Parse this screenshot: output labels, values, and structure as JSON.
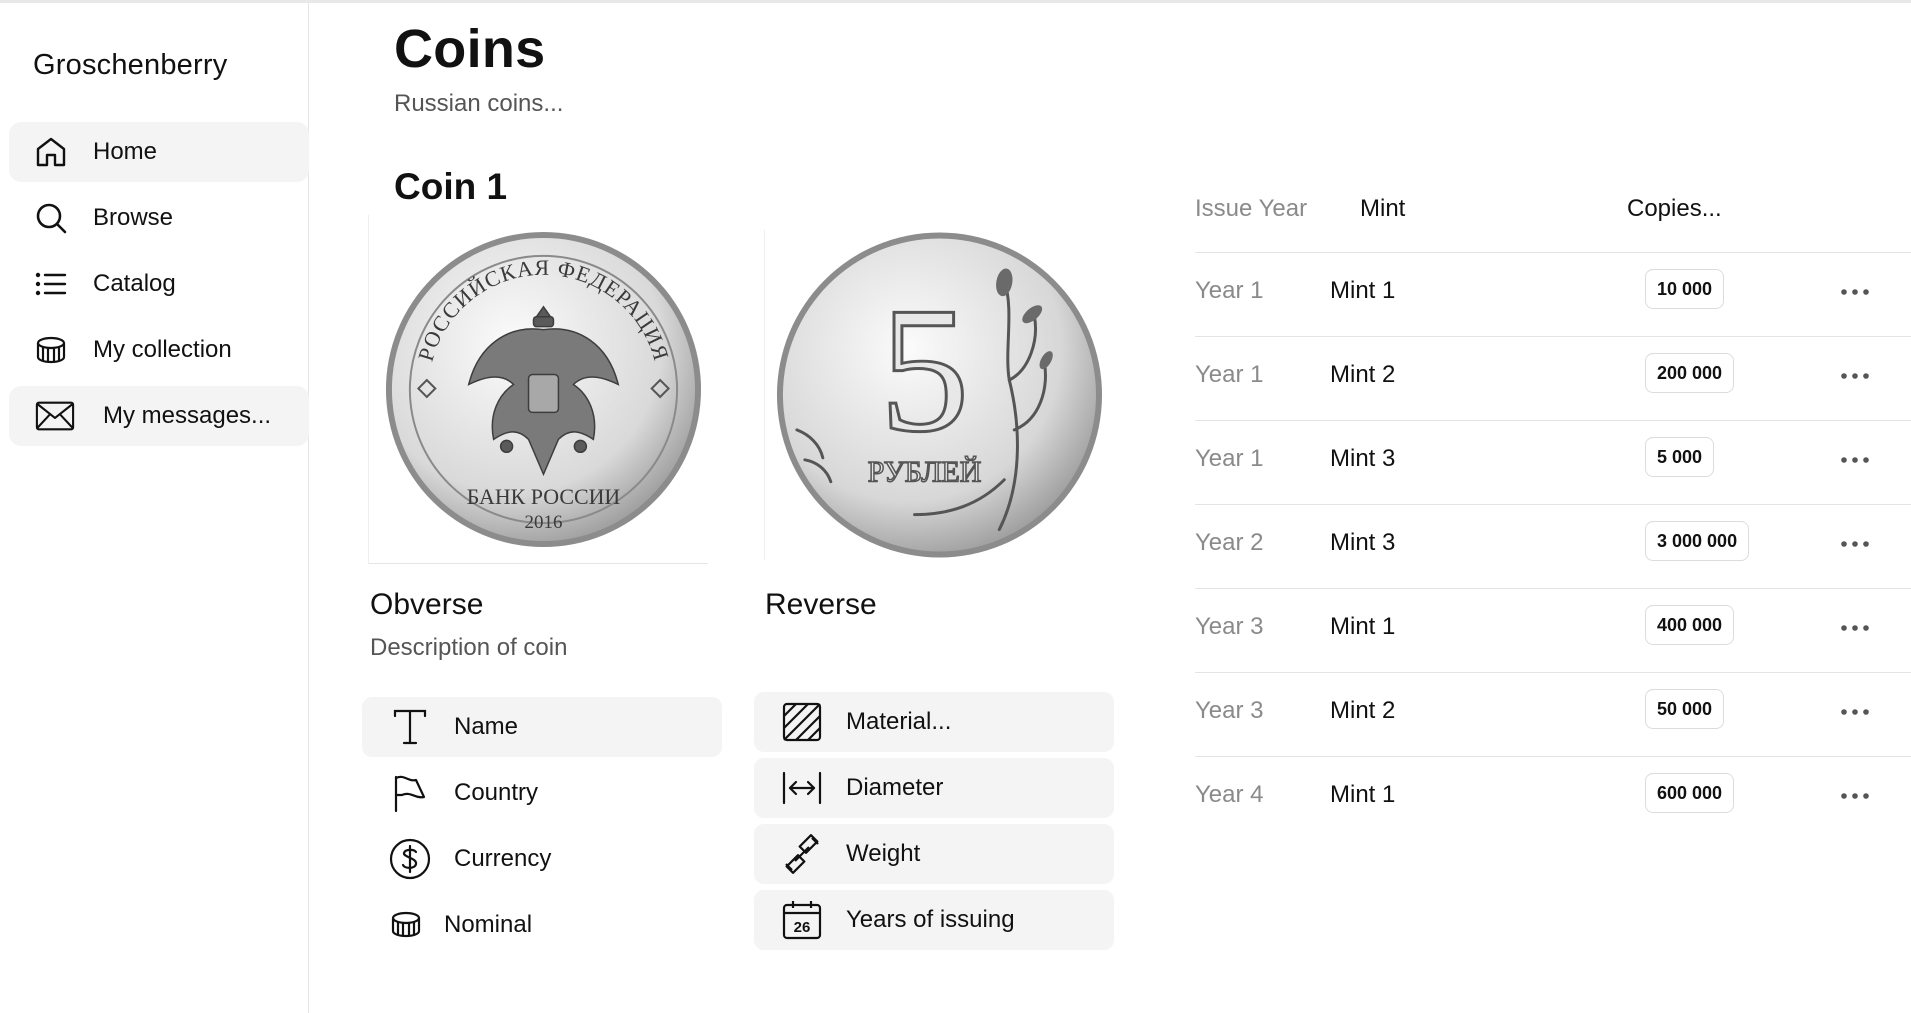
{
  "app": {
    "brand": "Groschenberry"
  },
  "sidebar": {
    "items": [
      {
        "label": "Home",
        "icon": "home-icon"
      },
      {
        "label": "Browse",
        "icon": "search-icon"
      },
      {
        "label": "Catalog",
        "icon": "list-icon"
      },
      {
        "label": "My collection",
        "icon": "coins-stack-icon"
      },
      {
        "label": "My messages...",
        "icon": "mail-icon"
      }
    ]
  },
  "header": {
    "title": "Coins",
    "subtitle": "Russian coins..."
  },
  "coin": {
    "title": "Coin 1",
    "obverse": {
      "label": "Obverse",
      "description": "Description of coin",
      "inscription_top": "РОССИЙСКАЯ ФЕДЕРАЦИЯ",
      "inscription_bottom": "БАНК РОССИИ",
      "year": "2016"
    },
    "reverse": {
      "label": "Reverse",
      "denomination": "5",
      "inscription": "РУБЛЕЙ"
    },
    "attributes_left": [
      {
        "label": "Name",
        "icon": "text-icon"
      },
      {
        "label": "Country",
        "icon": "flag-icon"
      },
      {
        "label": "Currency",
        "icon": "dollar-circle-icon"
      },
      {
        "label": "Nominal",
        "icon": "coins-stack-icon"
      }
    ],
    "attributes_right": [
      {
        "label": "Material...",
        "icon": "texture-icon"
      },
      {
        "label": "Diameter",
        "icon": "width-icon"
      },
      {
        "label": "Weight",
        "icon": "dumbbell-icon"
      },
      {
        "label": "Years of issuing",
        "icon": "calendar-icon",
        "icon_text": "26"
      }
    ]
  },
  "issues": {
    "columns": [
      "Issue Year",
      "Mint",
      "Copies..."
    ],
    "rows": [
      {
        "year": "Year 1",
        "mint": "Mint 1",
        "copies": "10 000"
      },
      {
        "year": "Year 1",
        "mint": "Mint 2",
        "copies": "200 000"
      },
      {
        "year": "Year 1",
        "mint": "Mint 3",
        "copies": "5 000"
      },
      {
        "year": "Year 2",
        "mint": "Mint 3",
        "copies": "3 000 000"
      },
      {
        "year": "Year 3",
        "mint": "Mint 1",
        "copies": "400 000"
      },
      {
        "year": "Year 3",
        "mint": "Mint 2",
        "copies": "50 000"
      },
      {
        "year": "Year 4",
        "mint": "Mint 1",
        "copies": "600 000"
      }
    ]
  },
  "colors": {
    "active_bg": "#f4f4f4",
    "border": "#e4e4e4",
    "muted_text": "#8a8a8a"
  }
}
